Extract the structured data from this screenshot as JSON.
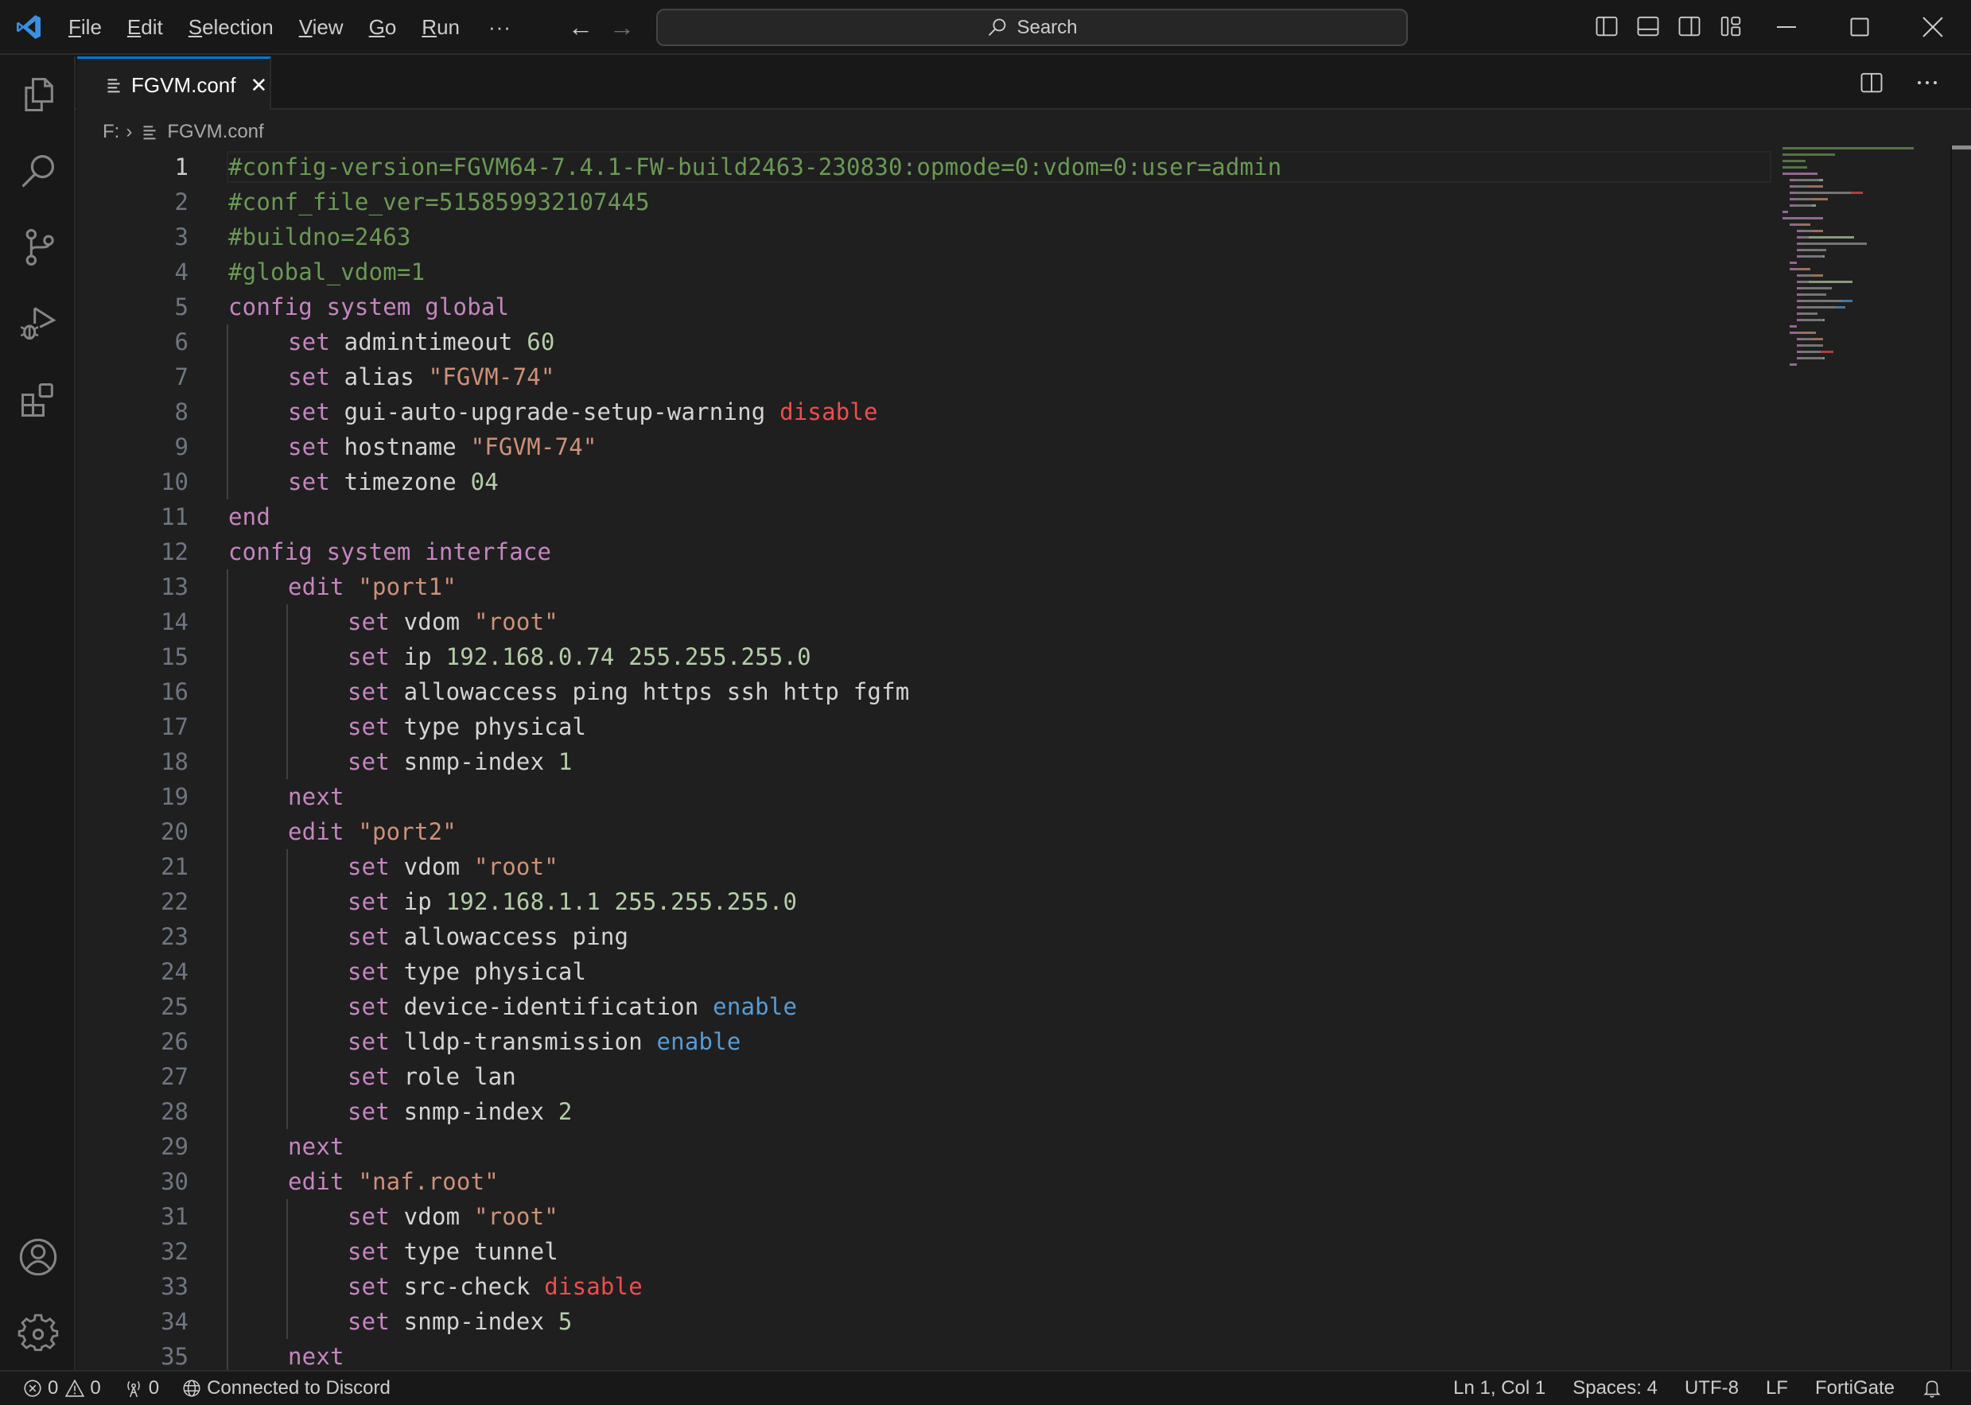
{
  "titlebar": {
    "menu": [
      {
        "label": "File",
        "accel": "F"
      },
      {
        "label": "Edit",
        "accel": "E"
      },
      {
        "label": "Selection",
        "accel": "S"
      },
      {
        "label": "View",
        "accel": "V"
      },
      {
        "label": "Go",
        "accel": "G"
      },
      {
        "label": "Run",
        "accel": "R"
      }
    ],
    "more_label": "···",
    "search_label": "Search"
  },
  "activitybar": {
    "icons": [
      "explorer-icon",
      "search-icon",
      "source-control-icon",
      "run-debug-icon",
      "extensions-icon"
    ],
    "bottom_icons": [
      "accounts-icon",
      "settings-gear-icon"
    ]
  },
  "tabs": [
    {
      "label": "FGVM.conf",
      "active": true
    }
  ],
  "breadcrumb": {
    "drive": "F:",
    "file": "FGVM.conf"
  },
  "editor": {
    "current_line": 1,
    "lines": [
      {
        "n": "1",
        "indent": 0,
        "tokens": [
          {
            "t": "#config-version=FGVM64-7.4.1-FW-build2463-230830:opmode=0:vdom=0:user=admin",
            "c": "comment"
          }
        ]
      },
      {
        "n": "2",
        "indent": 0,
        "tokens": [
          {
            "t": "#conf_file_ver=515859932107445",
            "c": "comment"
          }
        ]
      },
      {
        "n": "3",
        "indent": 0,
        "tokens": [
          {
            "t": "#buildno=2463",
            "c": "comment"
          }
        ]
      },
      {
        "n": "4",
        "indent": 0,
        "tokens": [
          {
            "t": "#global_vdom=1",
            "c": "comment"
          }
        ]
      },
      {
        "n": "5",
        "indent": 0,
        "tokens": [
          {
            "t": "config system global",
            "c": "kw"
          }
        ]
      },
      {
        "n": "6",
        "indent": 1,
        "tokens": [
          {
            "t": "set",
            "c": "kw"
          },
          {
            "t": " admintimeout ",
            "c": "plain"
          },
          {
            "t": "60",
            "c": "num"
          }
        ]
      },
      {
        "n": "7",
        "indent": 1,
        "tokens": [
          {
            "t": "set",
            "c": "kw"
          },
          {
            "t": " alias ",
            "c": "plain"
          },
          {
            "t": "\"FGVM-74\"",
            "c": "str"
          }
        ]
      },
      {
        "n": "8",
        "indent": 1,
        "tokens": [
          {
            "t": "set",
            "c": "kw"
          },
          {
            "t": " gui-auto-upgrade-setup-warning ",
            "c": "plain"
          },
          {
            "t": "disable",
            "c": "dis"
          }
        ]
      },
      {
        "n": "9",
        "indent": 1,
        "tokens": [
          {
            "t": "set",
            "c": "kw"
          },
          {
            "t": " hostname ",
            "c": "plain"
          },
          {
            "t": "\"FGVM-74\"",
            "c": "str"
          }
        ]
      },
      {
        "n": "10",
        "indent": 1,
        "tokens": [
          {
            "t": "set",
            "c": "kw"
          },
          {
            "t": " timezone ",
            "c": "plain"
          },
          {
            "t": "04",
            "c": "num"
          }
        ]
      },
      {
        "n": "11",
        "indent": 0,
        "tokens": [
          {
            "t": "end",
            "c": "kw"
          }
        ]
      },
      {
        "n": "12",
        "indent": 0,
        "tokens": [
          {
            "t": "config system interface",
            "c": "kw"
          }
        ]
      },
      {
        "n": "13",
        "indent": 1,
        "tokens": [
          {
            "t": "edit",
            "c": "kw"
          },
          {
            "t": " ",
            "c": "plain"
          },
          {
            "t": "\"port1\"",
            "c": "str"
          }
        ]
      },
      {
        "n": "14",
        "indent": 2,
        "tokens": [
          {
            "t": "set",
            "c": "kw"
          },
          {
            "t": " vdom ",
            "c": "plain"
          },
          {
            "t": "\"root\"",
            "c": "str"
          }
        ]
      },
      {
        "n": "15",
        "indent": 2,
        "tokens": [
          {
            "t": "set",
            "c": "kw"
          },
          {
            "t": " ip ",
            "c": "plain"
          },
          {
            "t": "192.168.0.74 255.255.255.0",
            "c": "num"
          }
        ]
      },
      {
        "n": "16",
        "indent": 2,
        "tokens": [
          {
            "t": "set",
            "c": "kw"
          },
          {
            "t": " allowaccess ping https ssh http fgfm",
            "c": "plain"
          }
        ]
      },
      {
        "n": "17",
        "indent": 2,
        "tokens": [
          {
            "t": "set",
            "c": "kw"
          },
          {
            "t": " type physical",
            "c": "plain"
          }
        ]
      },
      {
        "n": "18",
        "indent": 2,
        "tokens": [
          {
            "t": "set",
            "c": "kw"
          },
          {
            "t": " snmp-index ",
            "c": "plain"
          },
          {
            "t": "1",
            "c": "num"
          }
        ]
      },
      {
        "n": "19",
        "indent": 1,
        "tokens": [
          {
            "t": "next",
            "c": "kw"
          }
        ]
      },
      {
        "n": "20",
        "indent": 1,
        "tokens": [
          {
            "t": "edit",
            "c": "kw"
          },
          {
            "t": " ",
            "c": "plain"
          },
          {
            "t": "\"port2\"",
            "c": "str"
          }
        ]
      },
      {
        "n": "21",
        "indent": 2,
        "tokens": [
          {
            "t": "set",
            "c": "kw"
          },
          {
            "t": " vdom ",
            "c": "plain"
          },
          {
            "t": "\"root\"",
            "c": "str"
          }
        ]
      },
      {
        "n": "22",
        "indent": 2,
        "tokens": [
          {
            "t": "set",
            "c": "kw"
          },
          {
            "t": " ip ",
            "c": "plain"
          },
          {
            "t": "192.168.1.1 255.255.255.0",
            "c": "num"
          }
        ]
      },
      {
        "n": "23",
        "indent": 2,
        "tokens": [
          {
            "t": "set",
            "c": "kw"
          },
          {
            "t": " allowaccess ping",
            "c": "plain"
          }
        ]
      },
      {
        "n": "24",
        "indent": 2,
        "tokens": [
          {
            "t": "set",
            "c": "kw"
          },
          {
            "t": " type physical",
            "c": "plain"
          }
        ]
      },
      {
        "n": "25",
        "indent": 2,
        "tokens": [
          {
            "t": "set",
            "c": "kw"
          },
          {
            "t": " device-identification ",
            "c": "plain"
          },
          {
            "t": "enable",
            "c": "en"
          }
        ]
      },
      {
        "n": "26",
        "indent": 2,
        "tokens": [
          {
            "t": "set",
            "c": "kw"
          },
          {
            "t": " lldp-transmission ",
            "c": "plain"
          },
          {
            "t": "enable",
            "c": "en"
          }
        ]
      },
      {
        "n": "27",
        "indent": 2,
        "tokens": [
          {
            "t": "set",
            "c": "kw"
          },
          {
            "t": " role lan",
            "c": "plain"
          }
        ]
      },
      {
        "n": "28",
        "indent": 2,
        "tokens": [
          {
            "t": "set",
            "c": "kw"
          },
          {
            "t": " snmp-index ",
            "c": "plain"
          },
          {
            "t": "2",
            "c": "num"
          }
        ]
      },
      {
        "n": "29",
        "indent": 1,
        "tokens": [
          {
            "t": "next",
            "c": "kw"
          }
        ]
      },
      {
        "n": "30",
        "indent": 1,
        "tokens": [
          {
            "t": "edit",
            "c": "kw"
          },
          {
            "t": " ",
            "c": "plain"
          },
          {
            "t": "\"naf.root\"",
            "c": "str"
          }
        ]
      },
      {
        "n": "31",
        "indent": 2,
        "tokens": [
          {
            "t": "set",
            "c": "kw"
          },
          {
            "t": " vdom ",
            "c": "plain"
          },
          {
            "t": "\"root\"",
            "c": "str"
          }
        ]
      },
      {
        "n": "32",
        "indent": 2,
        "tokens": [
          {
            "t": "set",
            "c": "kw"
          },
          {
            "t": " type tunnel",
            "c": "plain"
          }
        ]
      },
      {
        "n": "33",
        "indent": 2,
        "tokens": [
          {
            "t": "set",
            "c": "kw"
          },
          {
            "t": " src-check ",
            "c": "plain"
          },
          {
            "t": "disable",
            "c": "dis"
          }
        ]
      },
      {
        "n": "34",
        "indent": 2,
        "tokens": [
          {
            "t": "set",
            "c": "kw"
          },
          {
            "t": " snmp-index ",
            "c": "plain"
          },
          {
            "t": "5",
            "c": "num"
          }
        ]
      },
      {
        "n": "35",
        "indent": 1,
        "tokens": [
          {
            "t": "next",
            "c": "kw"
          }
        ]
      }
    ]
  },
  "statusbar": {
    "errors": "0",
    "warnings": "0",
    "ports": "0",
    "discord": "Connected to Discord",
    "cursor": "Ln 1, Col 1",
    "indent": "Spaces: 4",
    "encoding": "UTF-8",
    "eol": "LF",
    "language": "FortiGate"
  },
  "colors": {
    "accent": "#0078d4",
    "comment": "#6a9955",
    "keyword": "#c586c0",
    "string": "#ce9178",
    "number": "#b5cea8",
    "disable": "#f14c4c",
    "enable": "#569cd6",
    "editor_bg": "#1f1f1f",
    "chrome_bg": "#181818"
  }
}
